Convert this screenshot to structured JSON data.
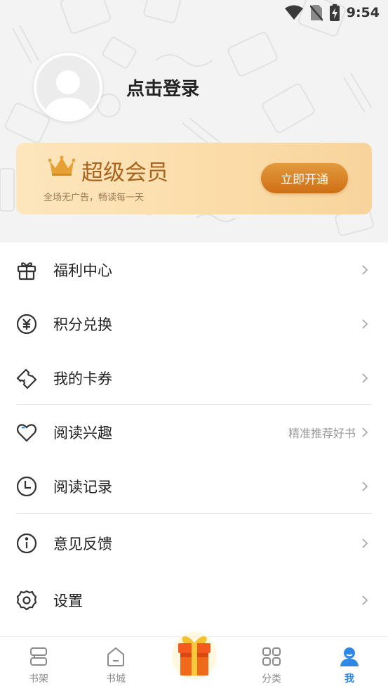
{
  "status_bar": {
    "time": "9:54",
    "icons": [
      "wifi-icon",
      "no-sim-icon",
      "battery-charging-icon"
    ]
  },
  "profile": {
    "avatar_icon": "default-avatar-icon",
    "login_label": "点击登录"
  },
  "vip": {
    "icon": "crown-icon",
    "title": "超级会员",
    "subtitle": "全场无广告，畅读每一天",
    "button_label": "立即开通",
    "colors": {
      "card": "#fbdca8",
      "title": "#a8641f",
      "button": "#d97a1e"
    }
  },
  "menu": {
    "items": [
      {
        "label": "福利中心",
        "icon": "gift-box-icon",
        "hint": ""
      },
      {
        "label": "积分兑换",
        "icon": "yen-coin-icon",
        "hint": ""
      },
      {
        "label": "我的卡券",
        "icon": "ticket-icon",
        "hint": ""
      },
      {
        "label": "阅读兴趣",
        "icon": "heart-icon",
        "hint": "精准推荐好书"
      },
      {
        "label": "阅读记录",
        "icon": "clock-icon",
        "hint": ""
      },
      {
        "label": "意见反馈",
        "icon": "info-icon",
        "hint": ""
      },
      {
        "label": "设置",
        "icon": "gear-icon",
        "hint": ""
      }
    ]
  },
  "tabbar": {
    "tabs": [
      {
        "label": "书架",
        "icon": "bookshelf-icon",
        "active": false
      },
      {
        "label": "书城",
        "icon": "bookstore-icon",
        "active": false
      },
      {
        "label": "",
        "icon": "gift-box-icon",
        "active": false
      },
      {
        "label": "分类",
        "icon": "category-grid-icon",
        "active": false
      },
      {
        "label": "我",
        "icon": "user-icon",
        "active": true
      }
    ],
    "colors": {
      "active": "#2e89e6",
      "inactive": "#8a8a8a"
    }
  }
}
